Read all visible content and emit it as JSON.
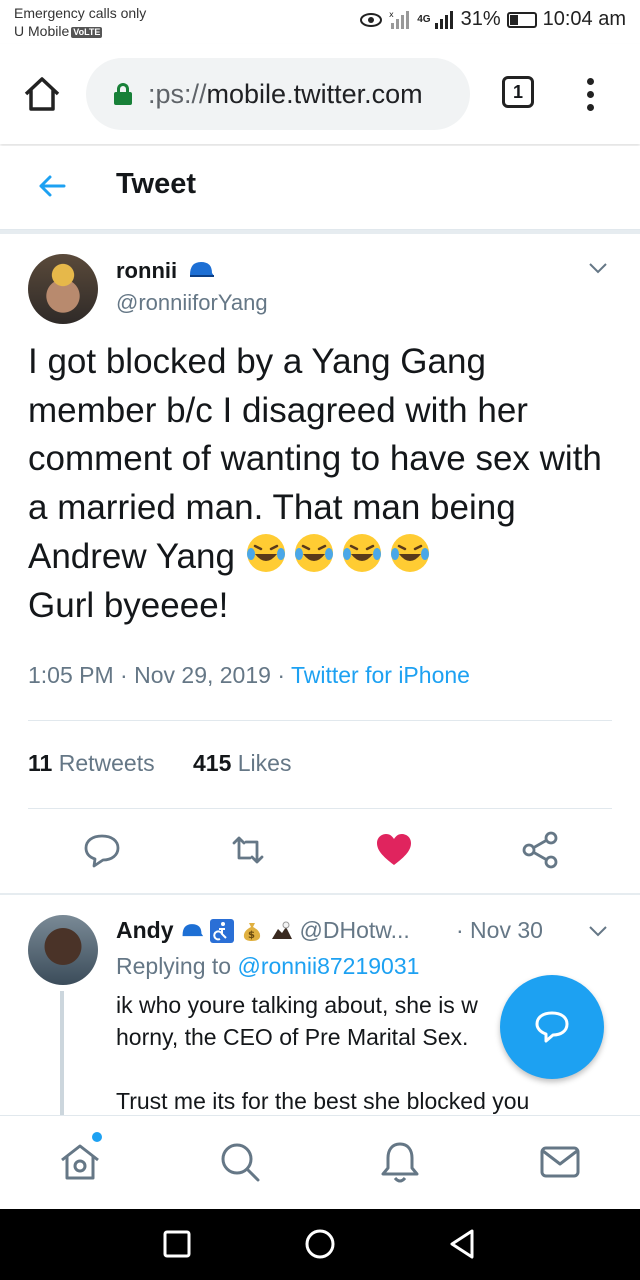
{
  "statusbar": {
    "carrier_line1": "Emergency calls only",
    "carrier_line2": "U Mobile",
    "volte": "VoLTE",
    "network": "4G",
    "battery": "31%",
    "time": "10:04 am"
  },
  "browser": {
    "url_prefix": ":ps://",
    "url_domain": "mobile.twitter.com",
    "tab_count": "1"
  },
  "header": {
    "title": "Tweet"
  },
  "tweet": {
    "name": "ronnii",
    "handle": "@ronniiforYang",
    "text_main": "I got blocked by a Yang Gang member b/c I disagreed with her comment of wanting to have sex with a married man. That man being Andrew Yang ",
    "text_end": "Gurl byeeee!",
    "time": "1:05 PM",
    "date": "Nov 29, 2019",
    "source": "Twitter for iPhone",
    "retweets_count": "11",
    "retweets_label": "Retweets",
    "likes_count": "415",
    "likes_label": "Likes"
  },
  "reply": {
    "name": "Andy",
    "handle": "@DHotw...",
    "date": "· Nov 30",
    "replying_label": "Replying to",
    "replying_handle": "@ronnii87219031",
    "text_line1": "ik who youre talking about, she is w",
    "text_line2": "horny, the CEO of Pre Marital Sex.",
    "text_line3": "Trust me its for the best she blocked you"
  },
  "colors": {
    "twitter_blue": "#1da1f2",
    "like_red": "#e0245e",
    "secure_green": "#188038"
  }
}
